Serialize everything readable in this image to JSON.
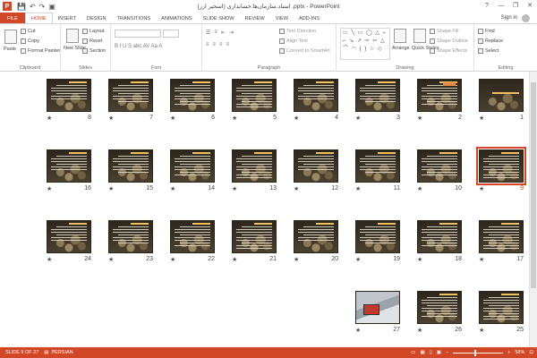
{
  "window": {
    "title": "اسناد.سازمان‌ها.حسابداری (اسحیر ارز) .pptx - PowerPoint",
    "app_icon": "P",
    "minimize": "—",
    "restore": "❐",
    "close": "✕",
    "help": "?"
  },
  "qat": {
    "save": "💾",
    "undo": "↶",
    "redo": "↷",
    "present": "▣"
  },
  "tabs": [
    "FILE",
    "HOME",
    "INSERT",
    "DESIGN",
    "TRANSITIONS",
    "ANIMATIONS",
    "SLIDE SHOW",
    "REVIEW",
    "VIEW",
    "ADD-INS"
  ],
  "active_tab": "HOME",
  "signin": "Sign in",
  "ribbon": {
    "clipboard": {
      "label": "Clipboard",
      "paste": "Paste",
      "cut": "Cut",
      "copy": "Copy",
      "format_painter": "Format Painter"
    },
    "slides": {
      "label": "Slides",
      "new_slide": "New Slide",
      "layout": "Layout",
      "reset": "Reset",
      "section": "Section"
    },
    "font": {
      "label": "Font",
      "formats": "B  I  U  S  abc  AV  Aa  A"
    },
    "paragraph": {
      "label": "Paragraph",
      "text_direction": "Text Direction",
      "align_text": "Align Text",
      "convert_smartart": "Convert to SmartArt"
    },
    "drawing": {
      "label": "Drawing",
      "shapes": "▭ ╲ ▭ ◯ △ ⌐ ⌐ ↘ ↗ ⇨ ⇦ △ ⌒ ◠ { } ☆ ◇",
      "arrange": "Arrange",
      "quick_styles": "Quick Styles",
      "shape_fill": "Shape Fill",
      "shape_outline": "Shape Outline",
      "shape_effects": "Shape Effects"
    },
    "editing": {
      "label": "Editing",
      "find": "Find",
      "replace": "Replace",
      "select": "Select"
    }
  },
  "slides_rows": [
    [
      "1",
      "2",
      "3",
      "4",
      "5",
      "6",
      "7",
      "8"
    ],
    [
      "9",
      "10",
      "11",
      "12",
      "13",
      "14",
      "15",
      "16"
    ],
    [
      "17",
      "18",
      "19",
      "20",
      "21",
      "22",
      "23",
      "24"
    ],
    [
      "25",
      "26",
      "27"
    ]
  ],
  "selected_slide": "9",
  "star_glyph": "★",
  "status": {
    "slide_indicator": "SLIDE 9 OF 27",
    "language": "PERSIAN",
    "zoom": "58%"
  },
  "colors": {
    "accent": "#d24726"
  }
}
